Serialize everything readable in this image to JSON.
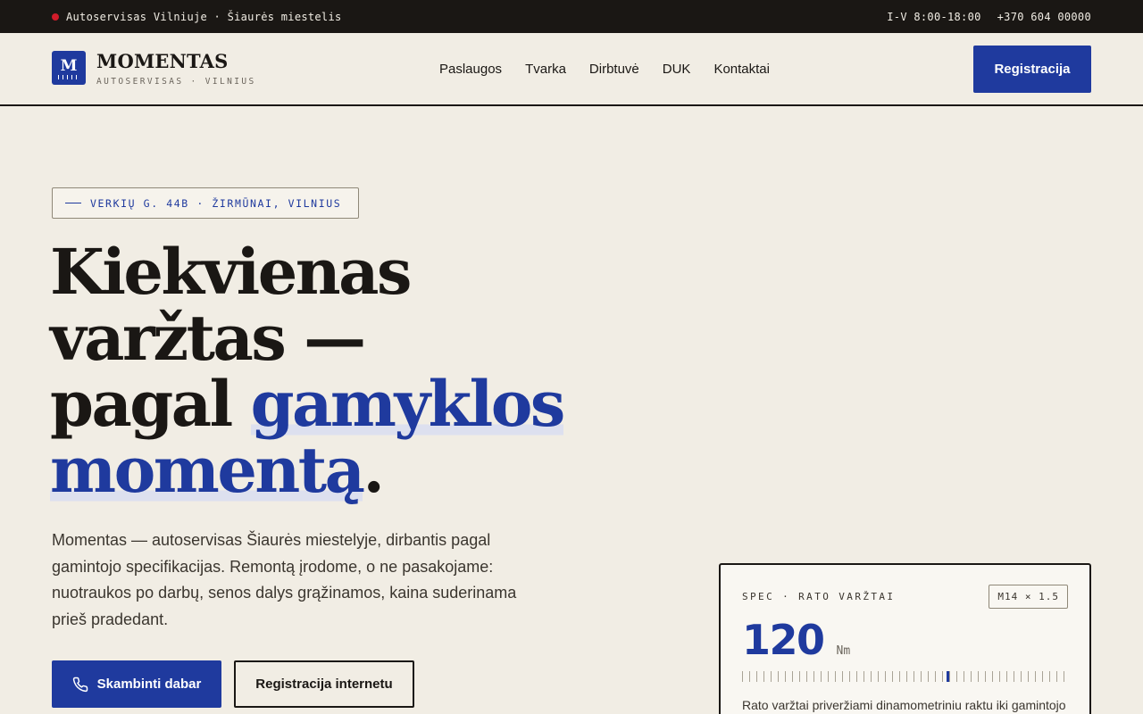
{
  "topbar": {
    "status_text": "Autoservisas Vilniuje · Šiaurės miestelis",
    "hours": "I-V 8:00-18:00",
    "phone": "+370 604 00000"
  },
  "header": {
    "logo_letter": "M",
    "brand": "MOMENTAS",
    "tagline": "AUTOSERVISAS · VILNIUS",
    "nav": [
      "Paslaugos",
      "Tvarka",
      "Dirbtuvė",
      "DUK",
      "Kontaktai"
    ],
    "cta": "Registracija"
  },
  "hero": {
    "address": "VERKIŲ G. 44B · ŽIRMŪNAI, VILNIUS",
    "headline_line1": "Kiekvienas",
    "headline_line2": "varžtas —",
    "headline_line3_plain": "pagal ",
    "headline_line3_blue": "gamyklos",
    "headline_line4_blue": "momentą",
    "headline_line4_end": ".",
    "lead": "Momentas — autoservisas Šiaurės miestelyje, dirbantis pagal gamintojo specifikacijas. Remontą įrodome, o ne pasakojame: nuotraukos po darbų, senos dalys grąžinamos, kaina suderinama prieš pradedant.",
    "btn_call": "Skambinti dabar",
    "btn_online": "Registracija internetu"
  },
  "spec": {
    "label": "SPEC · RATO VARŽTAI",
    "tag": "M14 × 1.5",
    "value": "120",
    "unit": "Nm",
    "description": "Rato varžtai priveržiami dinamometriniu raktu iki gamintojo"
  },
  "colors": {
    "accent": "#1f3a9e",
    "ink": "#1a1714",
    "paper": "#f1ede4",
    "alert_dot": "#d01c2a"
  }
}
